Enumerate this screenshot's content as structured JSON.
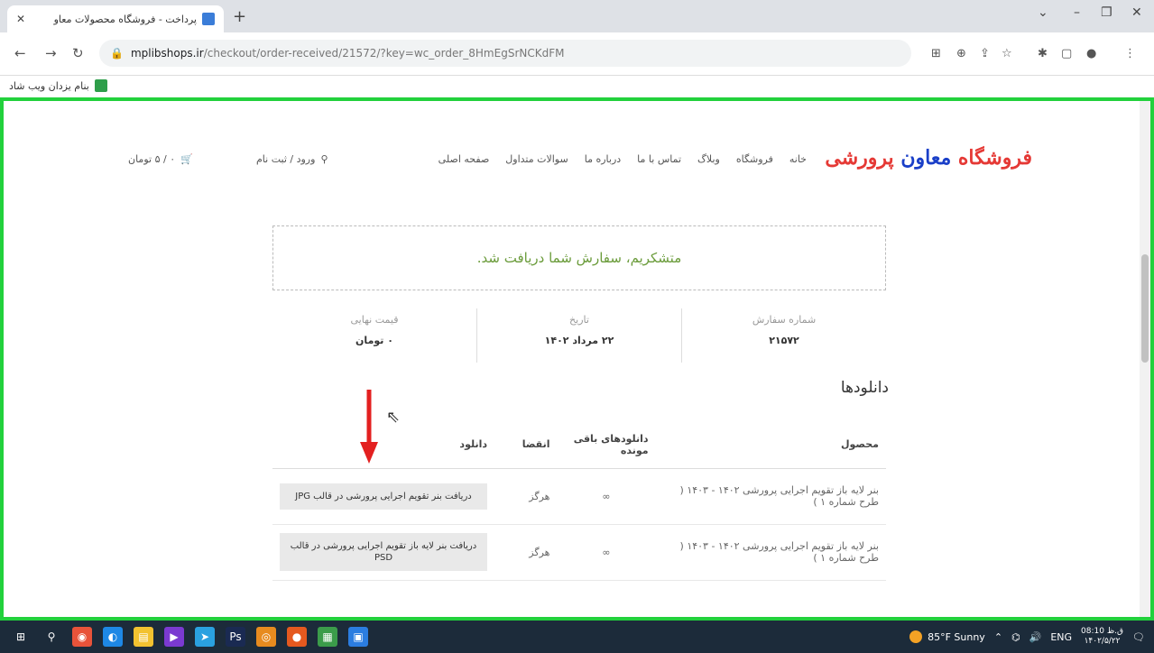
{
  "browser": {
    "tab_title": "پرداخت - فروشگاه محصولات معاو",
    "close": "✕",
    "newtab": "+",
    "address": {
      "host": "mplibshops.ir",
      "path": "/checkout/order-received/21572/?key=wc_order_8HmEgSrNCKdFM"
    },
    "bookmark": "بنام یزدان ویب شاد"
  },
  "site": {
    "logo_red": "فروشگاه ",
    "logo_blue": "معاون",
    "logo_red2": " پرورشی",
    "menu": [
      "خانه",
      "فروشگاه",
      "وبلاگ",
      "تماس با ما",
      "درباره ما",
      "سوالات متداول",
      "صفحه اصلی"
    ],
    "account": "ورود / ثبت نام",
    "cart": "۰ / ۵ تومان"
  },
  "thanks": "متشکریم، سفارش شما دریافت شد.",
  "overview": [
    {
      "label": "شماره سفارش",
      "value": "۲۱۵۷۲"
    },
    {
      "label": "تاریخ",
      "value": "۲۲ مرداد ۱۴۰۲"
    },
    {
      "label": "قیمت نهایی",
      "value": "۰ تومان"
    }
  ],
  "downloads": {
    "title": "دانلودها",
    "headers": [
      "محصول",
      "دانلودهای باقی مونده",
      "انقضا",
      "دانلود"
    ],
    "rows": [
      {
        "product": "بنر لایه باز تقویم اجرایی پرورشی ۱۴۰۲ - ۱۴۰۳ ( طرح شماره ۱ )",
        "remaining": "∞",
        "expires": "هرگز",
        "download": "دریافت بنر تقویم اجرایی پرورشی در قالب JPG"
      },
      {
        "product": "بنر لایه باز تقویم اجرایی پرورشی ۱۴۰۲ - ۱۴۰۳ ( طرح شماره ۱ )",
        "remaining": "∞",
        "expires": "هرگز",
        "download": "دریافت بنر لایه باز تقویم اجرایی پرورشی در قالب PSD"
      }
    ]
  },
  "taskbar": {
    "weather": "85°F Sunny",
    "lang": "ENG",
    "time": "08:10 ق.ظ",
    "date": "۱۴۰۲/۵/۲۲"
  }
}
